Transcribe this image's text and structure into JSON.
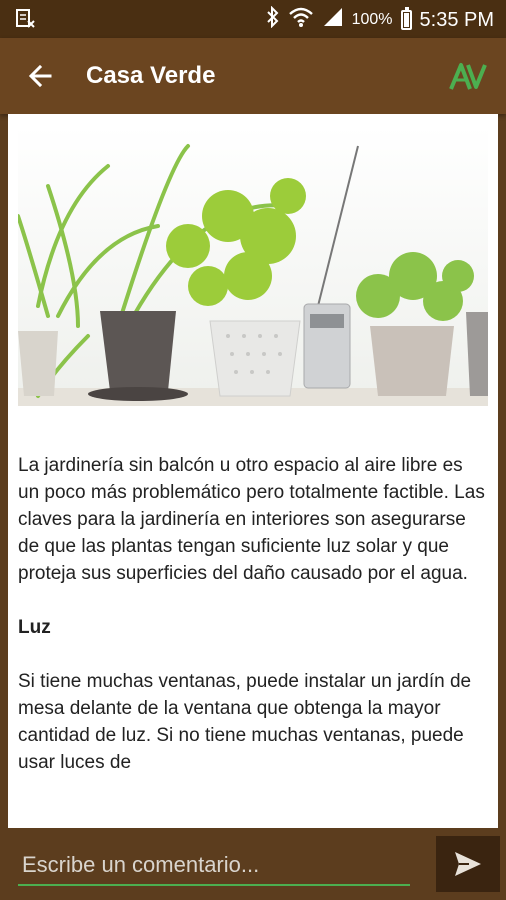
{
  "status_bar": {
    "battery_percent": "100%",
    "time": "5:35 PM",
    "icons": [
      "notification-download-icon",
      "bluetooth-icon",
      "wifi-icon",
      "signal-icon",
      "battery-icon"
    ]
  },
  "app_bar": {
    "title": "Casa Verde",
    "logo_icon": "brand-logo-icon",
    "accent_color": "#4caf50"
  },
  "article": {
    "intro": "La jardinería sin balcón u otro espacio al aire libre es un poco más problemático pero totalmente factible. Las claves para la jardinería en interiores son asegurarse de que las plantas tengan suficiente luz solar y que proteja sus superficies del daño causado por el agua.",
    "section_heading": "Luz",
    "section_body": "Si tiene muchas ventanas, puede instalar un jardín de mesa delante de la ventana que obtenga la mayor cantidad de luz. Si no tiene muchas ventanas, puede usar luces de"
  },
  "comment": {
    "placeholder": "Escribe un comentario...",
    "value": ""
  },
  "colors": {
    "status_bar": "#4a2f12",
    "app_bar": "#6b4520",
    "bottom_bar": "#5c3d1e",
    "send_button": "#3a2410"
  }
}
